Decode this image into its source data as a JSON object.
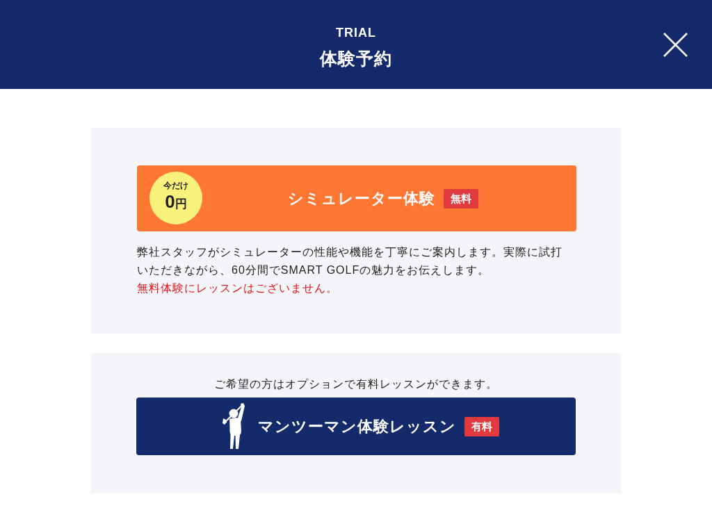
{
  "header": {
    "subtitle": "TRIAL",
    "title": "体験予約"
  },
  "simulator_trial": {
    "promo": {
      "label": "今だけ",
      "amount": "0",
      "unit": "円"
    },
    "title": "シミュレーター体験",
    "tag": "無料",
    "description": "弊社スタッフがシミュレーターの性能や機能を丁寧にご案内します。実際に試打いただきながら、60分間でSMART GOLFの魅力をお伝えします。",
    "notice": "無料体験にレッスンはございません。"
  },
  "lesson_option": {
    "intro": "ご希望の方はオプションで有料レッスンができます。",
    "title": "マンツーマン体験レッスン",
    "tag": "有料"
  }
}
